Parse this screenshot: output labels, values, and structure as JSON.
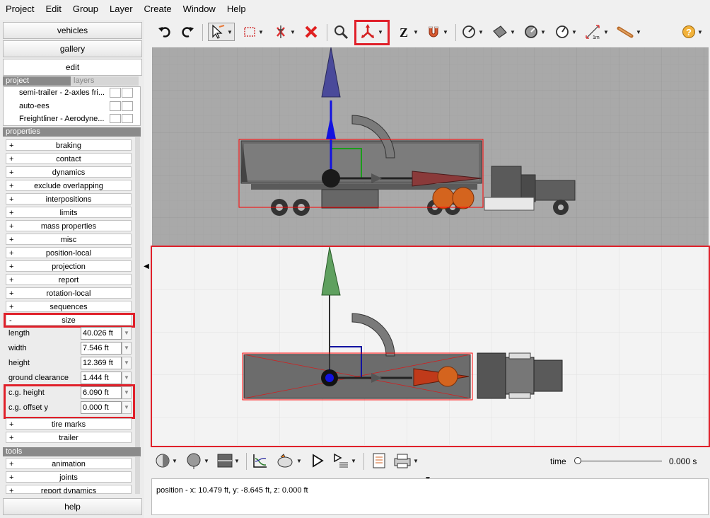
{
  "menu": [
    "Project",
    "Edit",
    "Group",
    "Layer",
    "Create",
    "Window",
    "Help"
  ],
  "nav": {
    "vehicles": "vehicles",
    "gallery": "gallery",
    "edit": "edit",
    "help": "help"
  },
  "tabs": {
    "project": "project",
    "layers": "layers"
  },
  "project_items": [
    "semi-trailer - 2-axles fri...",
    "auto-ees",
    "Freightliner - Aerodyne..."
  ],
  "headers": {
    "properties": "properties",
    "tools": "tools"
  },
  "properties": [
    {
      "sign": "+",
      "label": "braking"
    },
    {
      "sign": "+",
      "label": "contact"
    },
    {
      "sign": "+",
      "label": "dynamics"
    },
    {
      "sign": "+",
      "label": "exclude overlapping"
    },
    {
      "sign": "+",
      "label": "interpositions"
    },
    {
      "sign": "+",
      "label": "limits"
    },
    {
      "sign": "+",
      "label": "mass properties"
    },
    {
      "sign": "+",
      "label": "misc"
    },
    {
      "sign": "+",
      "label": "position-local"
    },
    {
      "sign": "+",
      "label": "projection"
    },
    {
      "sign": "+",
      "label": "report"
    },
    {
      "sign": "+",
      "label": "rotation-local"
    },
    {
      "sign": "+",
      "label": "sequences"
    },
    {
      "sign": "-",
      "label": "size"
    }
  ],
  "size_fields": [
    {
      "label": "length",
      "value": "40.026 ft"
    },
    {
      "label": "width",
      "value": "7.546 ft"
    },
    {
      "label": "height",
      "value": "12.369 ft"
    },
    {
      "label": "ground clearance",
      "value": "1.444 ft"
    },
    {
      "label": "c.g. height",
      "value": "6.090 ft"
    },
    {
      "label": "c.g. offset y",
      "value": "0.000 ft"
    }
  ],
  "properties_after": [
    {
      "sign": "+",
      "label": "tire marks"
    },
    {
      "sign": "+",
      "label": "trailer"
    }
  ],
  "tools": [
    {
      "sign": "+",
      "label": "animation"
    },
    {
      "sign": "+",
      "label": "joints"
    },
    {
      "sign": "+",
      "label": "report dynamics"
    }
  ],
  "time": {
    "label": "time",
    "value": "0.000 s"
  },
  "status": "position - x: 10.479 ft, y: -8.645 ft, z: 0.000 ft",
  "colors": {
    "highlight": "#e0202a",
    "axis_up": "#4a4a9a",
    "axis_green": "#5fa05f",
    "selection": "#ff0000"
  }
}
